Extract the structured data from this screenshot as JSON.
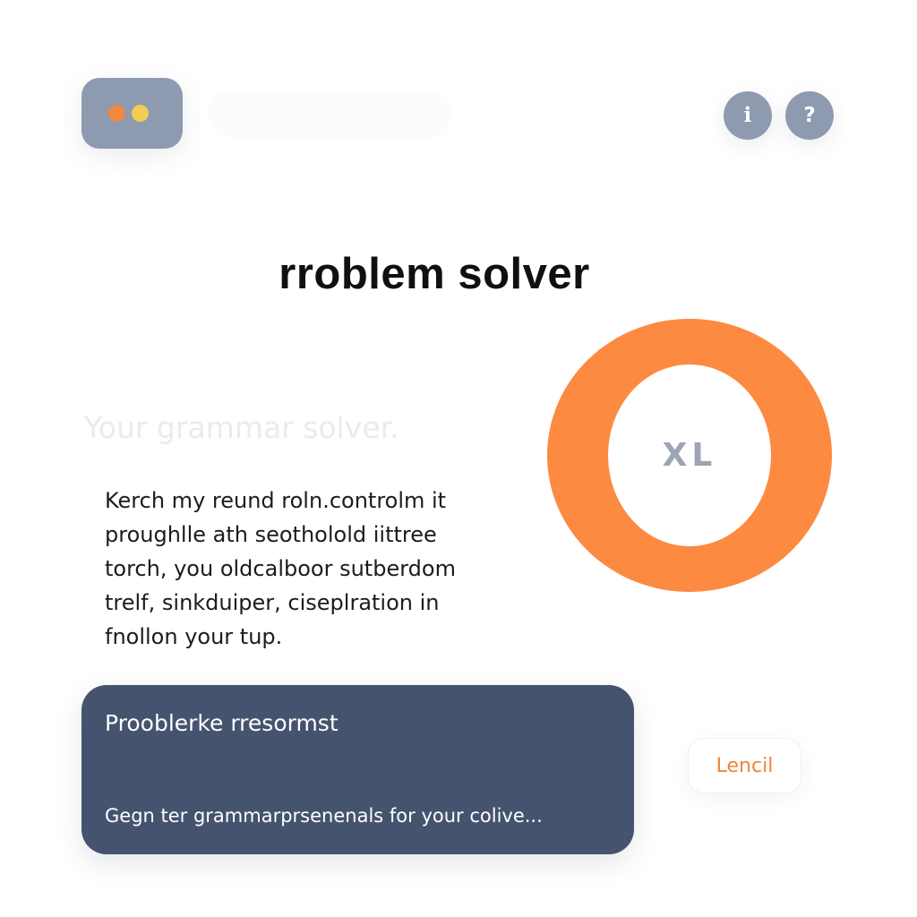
{
  "header": {
    "logo_icon": "window-dots-icon",
    "search_placeholder": "",
    "user_button_glyph": "ℹ",
    "user_button_icon": "user-info-icon",
    "help_button_glyph": "?",
    "help_button_icon": "help-icon"
  },
  "title": "rroblem solver",
  "subtitle": "Your grammar solver.",
  "body_lines": [
    "Kerch my reund roln.controlm it",
    "proughlle ath seotholold iittree",
    "torch, you oldcalboor sutberdom",
    "trelf, sinkduiper, ciseplration in",
    "fnollon your tup."
  ],
  "ring_label": "XL",
  "card": {
    "title": "Prooblerke rresormst",
    "description": "Gegn ter grammarprsenenals for your colive..."
  },
  "action_button": "Lencil",
  "colors": {
    "accent_orange": "#fd8a41",
    "accent_yellow": "#f2cc53",
    "slate": "#8d9ab0",
    "card_navy": "#45536f"
  }
}
